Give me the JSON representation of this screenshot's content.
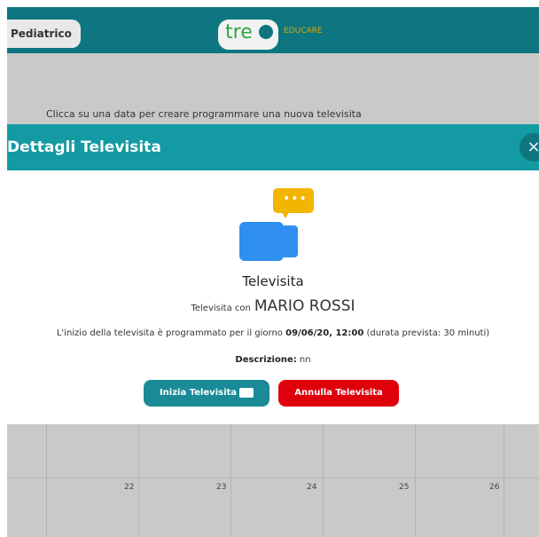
{
  "header": {
    "role_label": "Pediatrico",
    "logo_text": "tre",
    "logo_sub": "EDUCARE"
  },
  "page": {
    "hint": "Clicca su una data per creare programmare una nuova televisita"
  },
  "modal": {
    "title": "Dettagli Televisita",
    "close_symbol": "×",
    "heading": "Televisita",
    "with_label": "Televisita con",
    "patient_name": "MARIO ROSSI",
    "schedule_prefix": "L'inizio della televisita è programmato per il giorno",
    "schedule_datetime": "09/06/20, 12:00",
    "schedule_suffix": "(durata prevista: 30 minuti)",
    "description_label": "Descrizione:",
    "description_value": "nn",
    "start_button": "Inizia Televisita",
    "cancel_button": "Annulla Televisita"
  },
  "calendar": {
    "days": [
      "22",
      "23",
      "24",
      "25",
      "26"
    ]
  },
  "icons": {
    "chat": "chat-bubble-icon",
    "camera": "video-camera-icon"
  },
  "colors": {
    "header": "#0d7680",
    "modal_header": "#139aa3",
    "start_button": "#1a8a96",
    "cancel_button": "#e0000c",
    "camera": "#2e8ff0",
    "chat": "#f2b500"
  }
}
